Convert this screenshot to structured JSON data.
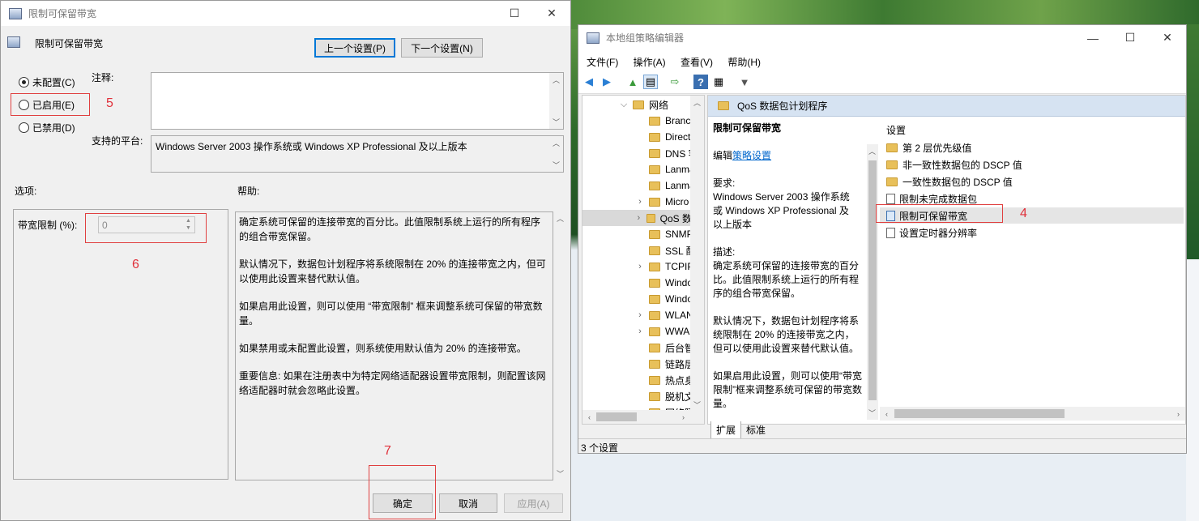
{
  "policy_dialog": {
    "window_title": "限制可保留带宽",
    "header": "限制可保留带宽",
    "prev_button": "上一个设置(P)",
    "next_button": "下一个设置(N)",
    "radio_not_configured": "未配置(C)",
    "radio_enabled": "已启用(E)",
    "radio_disabled": "已禁用(D)",
    "comment_label": "注释:",
    "platform_label": "支持的平台:",
    "platform_text": "Windows Server 2003 操作系统或 Windows XP Professional 及以上版本",
    "options_label": "选项:",
    "help_label": "帮助:",
    "bandwidth_label": "带宽限制 (%):",
    "bandwidth_value": "0",
    "help_paragraphs": [
      "确定系统可保留的连接带宽的百分比。此值限制系统上运行的所有程序的组合带宽保留。",
      "默认情况下，数据包计划程序将系统限制在 20% 的连接带宽之内，但可以使用此设置来替代默认值。",
      "如果启用此设置，则可以使用 “带宽限制” 框来调整系统可保留的带宽数量。",
      "如果禁用或未配置此设置，则系统使用默认值为 20% 的连接带宽。",
      "重要信息: 如果在注册表中为特定网络适配器设置带宽限制，则配置该网络适配器时就会忽略此设置。"
    ],
    "ok_button": "确定",
    "cancel_button": "取消",
    "apply_button": "应用(A)",
    "annotation_5": "5",
    "annotation_6": "6",
    "annotation_7": "7"
  },
  "mmc": {
    "window_title": "本地组策略编辑器",
    "menu": [
      "文件(F)",
      "操作(A)",
      "查看(V)",
      "帮助(H)"
    ],
    "tree": [
      {
        "label": "网络",
        "expander": "⌵",
        "indent": 0
      },
      {
        "label": "Brancl",
        "expander": "",
        "indent": 1
      },
      {
        "label": "Direct",
        "expander": "",
        "indent": 1
      },
      {
        "label": "DNS 客",
        "expander": "",
        "indent": 1
      },
      {
        "label": "Lanma",
        "expander": "",
        "indent": 1
      },
      {
        "label": "Lanma",
        "expander": "",
        "indent": 1
      },
      {
        "label": "Micro",
        "expander": "›",
        "indent": 1
      },
      {
        "label": "QoS 数",
        "expander": "›",
        "indent": 1,
        "selected": true
      },
      {
        "label": "SNMP",
        "expander": "",
        "indent": 1
      },
      {
        "label": "SSL 配",
        "expander": "",
        "indent": 1
      },
      {
        "label": "TCPIP",
        "expander": "›",
        "indent": 1
      },
      {
        "label": "Windo",
        "expander": "",
        "indent": 1
      },
      {
        "label": "Windo",
        "expander": "",
        "indent": 1
      },
      {
        "label": "WLAN",
        "expander": "›",
        "indent": 1
      },
      {
        "label": "WWAN",
        "expander": "›",
        "indent": 1
      },
      {
        "label": "后台智",
        "expander": "",
        "indent": 1
      },
      {
        "label": "链路层",
        "expander": "",
        "indent": 1
      },
      {
        "label": "热点身",
        "expander": "",
        "indent": 1
      },
      {
        "label": "脱机文",
        "expander": "",
        "indent": 1
      },
      {
        "label": "网络隔",
        "expander": "",
        "indent": 1
      }
    ],
    "content_header": "QoS 数据包计划程序",
    "desc_title": "限制可保留带宽",
    "edit_prefix": "编辑",
    "edit_link": "策略设置",
    "desc_lines": [
      "要求:",
      "Windows Server 2003 操作系统",
      "或 Windows XP Professional 及",
      "以上版本",
      "",
      "描述:",
      "确定系统可保留的连接带宽的百分",
      "比。此值限制系统上运行的所有程",
      "序的组合带宽保留。",
      "",
      "默认情况下，数据包计划程序将系",
      "统限制在 20% 的连接带宽之内，",
      "但可以使用此设置来替代默认值。",
      "",
      "如果启用此设置，则可以使用“带宽",
      "限制”框来调整系统可保留的带宽数",
      "量。"
    ],
    "list_header": "设置",
    "list": [
      {
        "label": "第 2 层优先级值",
        "type": "folder"
      },
      {
        "label": "非一致性数据包的 DSCP 值",
        "type": "folder"
      },
      {
        "label": "一致性数据包的 DSCP 值",
        "type": "folder"
      },
      {
        "label": "限制未完成数据包",
        "type": "doc"
      },
      {
        "label": "限制可保留带宽",
        "type": "doc",
        "selected": true
      },
      {
        "label": "设置定时器分辨率",
        "type": "doc"
      }
    ],
    "tab_extended": "扩展",
    "tab_standard": "标准",
    "status": "3 个设置",
    "annotation_4": "4"
  }
}
